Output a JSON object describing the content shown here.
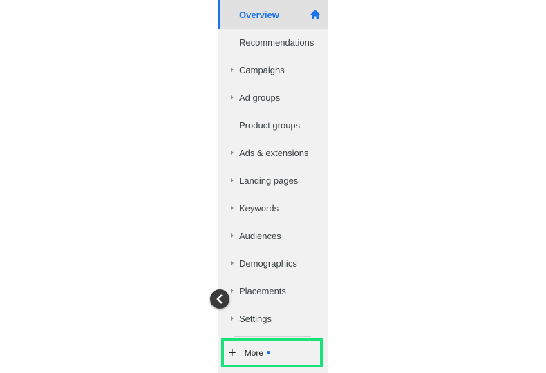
{
  "sidebar": {
    "items": [
      {
        "label": "Overview",
        "active": true,
        "icon": "home-icon"
      },
      {
        "label": "Recommendations",
        "expandable": false
      },
      {
        "label": "Campaigns",
        "expandable": true
      },
      {
        "label": "Ad groups",
        "expandable": true
      },
      {
        "label": "Product groups",
        "expandable": false
      },
      {
        "label": "Ads & extensions",
        "expandable": true
      },
      {
        "label": "Landing pages",
        "expandable": true
      },
      {
        "label": "Keywords",
        "expandable": true
      },
      {
        "label": "Audiences",
        "expandable": true
      },
      {
        "label": "Demographics",
        "expandable": true
      },
      {
        "label": "Placements",
        "expandable": true
      },
      {
        "label": "Settings",
        "expandable": true
      }
    ],
    "more": {
      "label": "More",
      "icon": "plus-icon",
      "has_notification_dot": true
    },
    "collapse_icon": "chevron-left-icon"
  },
  "colors": {
    "accent": "#1a73e8",
    "highlight_border": "#19e27a",
    "sidebar_bg": "#f1f1f1"
  }
}
